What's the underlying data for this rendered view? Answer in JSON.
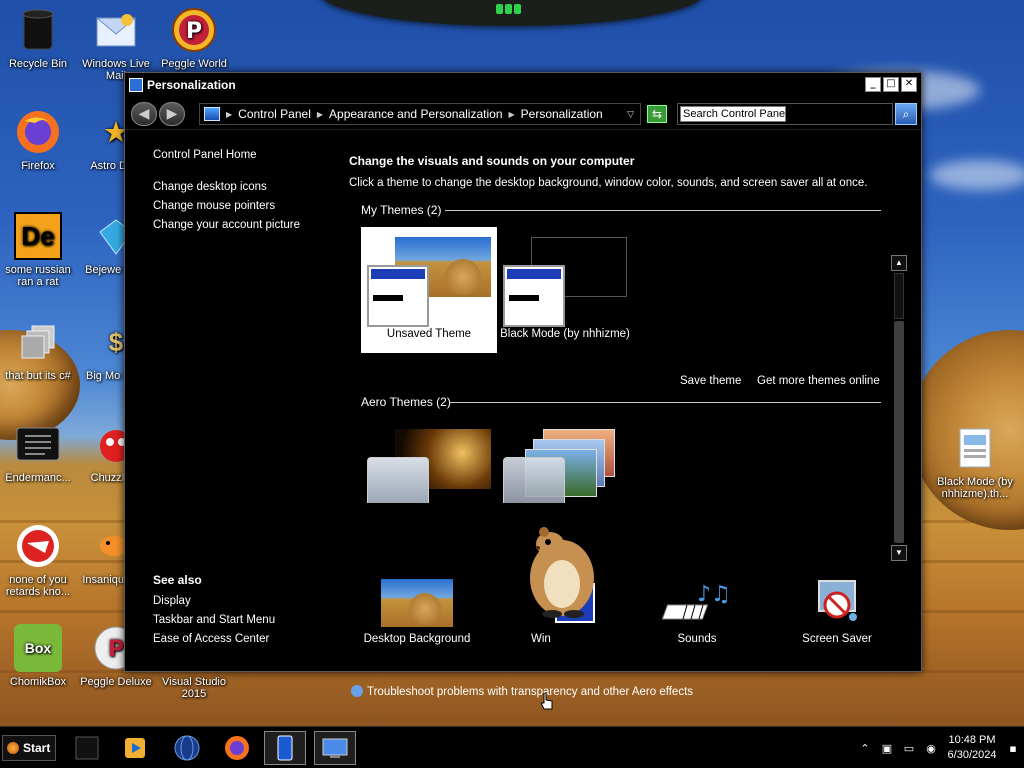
{
  "desktop": {
    "icons": [
      {
        "label": "Recycle Bin"
      },
      {
        "label": "Windows Live Mail"
      },
      {
        "label": "Peggle World"
      },
      {
        "label": "Firefox"
      },
      {
        "label": "Astro Delu"
      },
      {
        "label": "some russian ran a rat"
      },
      {
        "label": "Bejewe Delu"
      },
      {
        "label": "that but its c#"
      },
      {
        "label": "Big Mo Delu"
      },
      {
        "label": "Endermanc..."
      },
      {
        "label": "Chuzzle D"
      },
      {
        "label": "none of you retards kno..."
      },
      {
        "label": "Insaniqu Delu"
      },
      {
        "label": "ChomikBox"
      },
      {
        "label": "Peggle Deluxe"
      },
      {
        "label": "Visual Studio 2015"
      },
      {
        "label": "Black Mode (by nhhizme).th..."
      }
    ]
  },
  "window": {
    "title": "Personalization",
    "buttons": {
      "minimize": "_",
      "maximize": "□",
      "close": "✕"
    }
  },
  "address": {
    "crumbs": [
      "Control Panel",
      "Appearance and Personalization",
      "Personalization"
    ],
    "search_placeholder": "Search Control Panel"
  },
  "sidebar": {
    "home": "Control Panel Home",
    "links": [
      "Change desktop icons",
      "Change mouse pointers",
      "Change your account picture"
    ],
    "see_also_header": "See also",
    "see_also": [
      "Display",
      "Taskbar and Start Menu",
      "Ease of Access Center"
    ]
  },
  "main": {
    "heading": "Change the visuals and sounds on your computer",
    "subheading": "Click a theme to change the desktop background, window color, sounds, and screen saver all at once.",
    "my_themes_header": "My Themes (2)",
    "my_themes": [
      {
        "label": "Unsaved Theme",
        "selected": true
      },
      {
        "label": "Black Mode (by nhhizme)",
        "selected": false
      }
    ],
    "save_theme": "Save theme",
    "get_more": "Get more themes online",
    "aero_themes_header": "Aero Themes (2)",
    "bottom": [
      {
        "label": "Desktop Background"
      },
      {
        "label": "Win"
      },
      {
        "label": "Sounds"
      },
      {
        "label": "Screen Saver"
      }
    ],
    "troubleshoot": "Troubleshoot problems with transparency and other Aero effects"
  },
  "taskbar": {
    "start": "Start",
    "time": "10:48 PM",
    "date": "6/30/2024"
  },
  "colors": {
    "window_bg": "#000000",
    "selected_theme_bg": "#ffffff",
    "accent_blue": "#1c3cb8"
  }
}
